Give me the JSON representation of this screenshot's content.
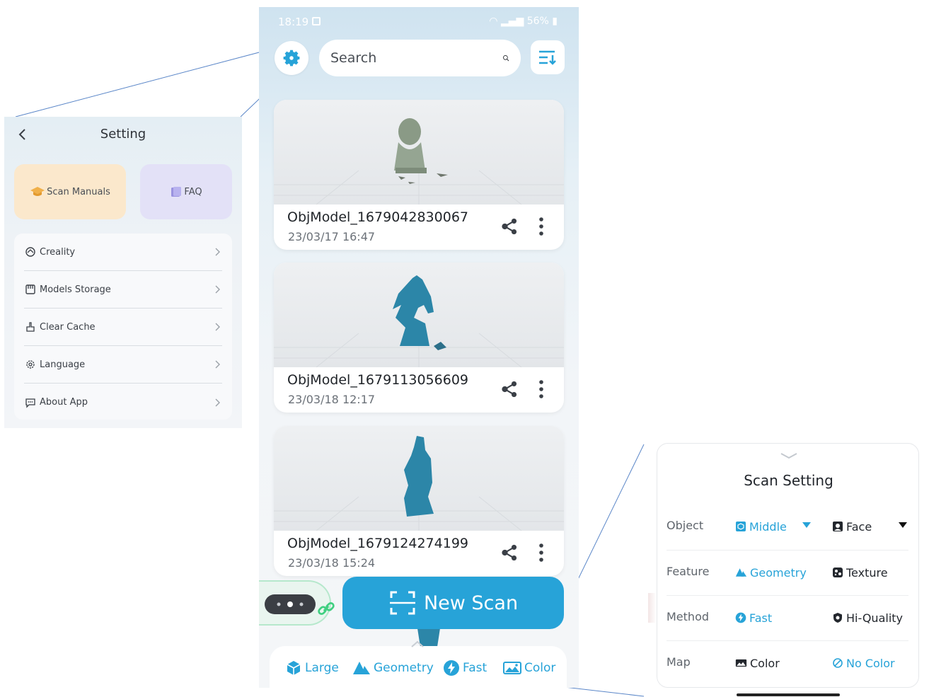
{
  "status_bar": {
    "time": "18:19",
    "battery": "56%"
  },
  "search": {
    "placeholder": "Search"
  },
  "models": [
    {
      "name": "ObjModel_1679042830067",
      "date": "23/03/17 16:47"
    },
    {
      "name": "ObjModel_1679113056609",
      "date": "23/03/18 12:17"
    },
    {
      "name": "ObjModel_1679124274199",
      "date": "23/03/18 15:24"
    }
  ],
  "new_scan": {
    "label": "New Scan"
  },
  "bottom_bar": [
    {
      "label": "Large",
      "icon": "cube-icon"
    },
    {
      "label": "Geometry",
      "icon": "triangles-icon"
    },
    {
      "label": "Fast",
      "icon": "bolt-icon"
    },
    {
      "label": "Color",
      "icon": "image-icon"
    }
  ],
  "settings_panel": {
    "title": "Setting",
    "tiles": {
      "manuals": "Scan Manuals",
      "faq": "FAQ"
    },
    "items": [
      {
        "label": "Creality",
        "icon": "creality-logo-icon"
      },
      {
        "label": "Models Storage",
        "icon": "storage-icon"
      },
      {
        "label": "Clear Cache",
        "icon": "broom-icon"
      },
      {
        "label": "Language",
        "icon": "gear-icon"
      },
      {
        "label": "About App",
        "icon": "chat-icon"
      }
    ]
  },
  "scan_setting": {
    "title": "Scan Setting",
    "rows": [
      {
        "label": "Object",
        "options": [
          "Middle",
          "Face"
        ],
        "selected": "Middle"
      },
      {
        "label": "Feature",
        "options": [
          "Geometry",
          "Texture"
        ],
        "selected": "Geometry"
      },
      {
        "label": "Method",
        "options": [
          "Fast",
          "Hi-Quality"
        ],
        "selected": "Fast"
      },
      {
        "label": "Map",
        "options": [
          "Color",
          "No Color"
        ],
        "selected": "No Color"
      }
    ]
  },
  "colors": {
    "accent": "#27a3d8",
    "text": "#23272d",
    "manual_tile": "#fbe8cc",
    "faq_tile": "#e3e1f7",
    "device_ring": "#3fcf80"
  }
}
